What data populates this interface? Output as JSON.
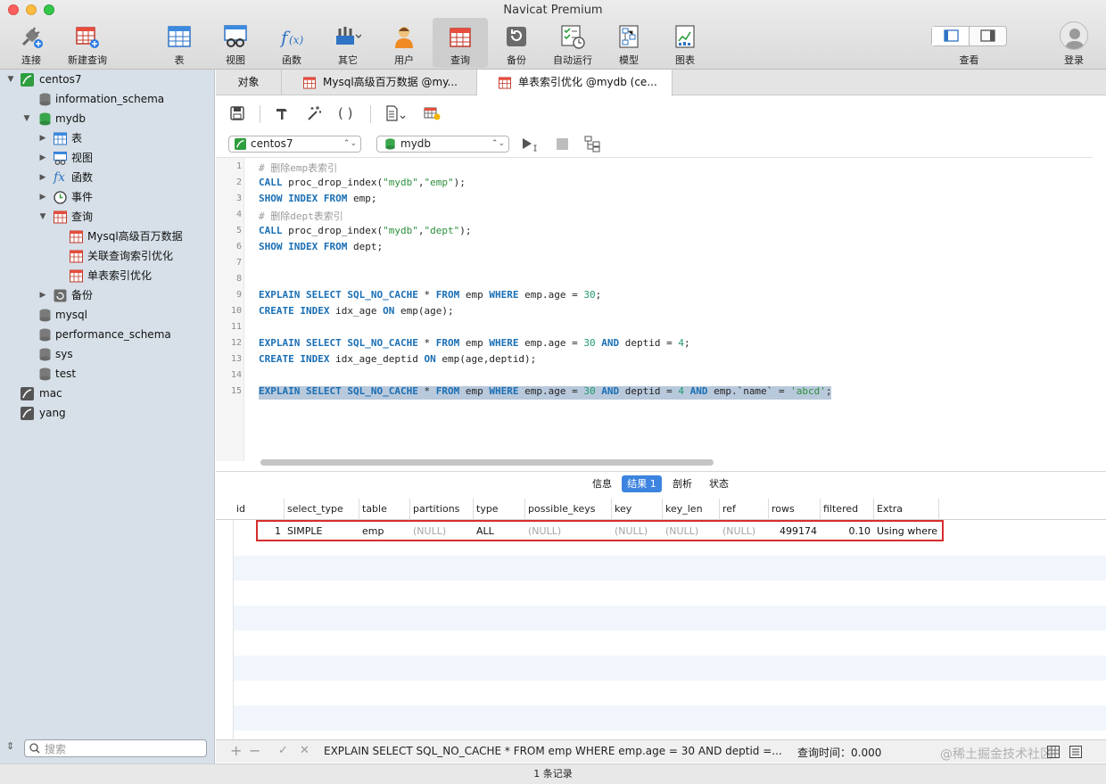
{
  "window": {
    "title": "Navicat Premium"
  },
  "toolbar": {
    "items": [
      {
        "label": "连接",
        "icon": "plug-icon"
      },
      {
        "label": "新建查询",
        "icon": "new-query-icon"
      },
      {
        "label": "表",
        "icon": "table-icon"
      },
      {
        "label": "视图",
        "icon": "view-icon"
      },
      {
        "label": "函数",
        "icon": "function-icon"
      },
      {
        "label": "其它",
        "icon": "tools-icon"
      },
      {
        "label": "用户",
        "icon": "user-icon"
      },
      {
        "label": "查询",
        "icon": "query-icon"
      },
      {
        "label": "备份",
        "icon": "backup-icon"
      },
      {
        "label": "自动运行",
        "icon": "schedule-icon"
      },
      {
        "label": "模型",
        "icon": "model-icon"
      },
      {
        "label": "图表",
        "icon": "chart-icon"
      }
    ],
    "view_label": "查看",
    "login_label": "登录"
  },
  "sidebar": {
    "tree": [
      {
        "label": "centos7"
      },
      {
        "label": "information_schema"
      },
      {
        "label": "mydb"
      },
      {
        "label": "表"
      },
      {
        "label": "视图"
      },
      {
        "label": "函数"
      },
      {
        "label": "事件"
      },
      {
        "label": "查询"
      },
      {
        "label": "Mysql高级百万数据"
      },
      {
        "label": "关联查询索引优化"
      },
      {
        "label": "单表索引优化"
      },
      {
        "label": "备份"
      },
      {
        "label": "mysql"
      },
      {
        "label": "performance_schema"
      },
      {
        "label": "sys"
      },
      {
        "label": "test"
      },
      {
        "label": "mac"
      },
      {
        "label": "yang"
      }
    ],
    "search_placeholder": "搜索"
  },
  "tabs": [
    {
      "label": "对象"
    },
    {
      "label": "Mysql高级百万数据 @my..."
    },
    {
      "label": "单表索引优化 @mydb (ce..."
    }
  ],
  "connection_select": "centos7",
  "database_select": "mydb",
  "editor": {
    "line_numbers": [
      "1",
      "2",
      "3",
      "4",
      "5",
      "6",
      "7",
      "8",
      "9",
      "10",
      "11",
      "12",
      "13",
      "14",
      "15"
    ],
    "lines": [
      "# 删除emp表索引",
      "CALL proc_drop_index(\"mydb\",\"emp\");",
      "SHOW INDEX FROM emp;",
      "# 删除dept表索引",
      "CALL proc_drop_index(\"mydb\",\"dept\");",
      "SHOW INDEX FROM dept;",
      "",
      "",
      "EXPLAIN SELECT SQL_NO_CACHE * FROM emp WHERE emp.age = 30;",
      "CREATE INDEX idx_age ON emp(age);",
      "",
      "EXPLAIN SELECT SQL_NO_CACHE * FROM emp WHERE emp.age = 30 AND deptid = 4;",
      "CREATE INDEX idx_age_deptid ON emp(age,deptid);",
      "",
      "EXPLAIN SELECT SQL_NO_CACHE * FROM emp WHERE emp.age = 30 AND deptid = 4 AND emp.`name` = 'abcd';"
    ]
  },
  "result_tabs": [
    {
      "label": "信息"
    },
    {
      "label": "结果 1"
    },
    {
      "label": "剖析"
    },
    {
      "label": "状态"
    }
  ],
  "result": {
    "columns": [
      "id",
      "select_type",
      "table",
      "partitions",
      "type",
      "possible_keys",
      "key",
      "key_len",
      "ref",
      "rows",
      "filtered",
      "Extra"
    ],
    "rows": [
      [
        "1",
        "SIMPLE",
        "emp",
        "(NULL)",
        "ALL",
        "(NULL)",
        "(NULL)",
        "(NULL)",
        "(NULL)",
        "499174",
        "0.10",
        "Using where"
      ]
    ]
  },
  "bottom": {
    "sql": "EXPLAIN SELECT SQL_NO_CACHE * FROM emp WHERE emp.age = 30 AND deptid =...",
    "query_time": "查询时间：0.000",
    "watermark": "@稀土掘金技术社区"
  },
  "status": "1 条记录"
}
